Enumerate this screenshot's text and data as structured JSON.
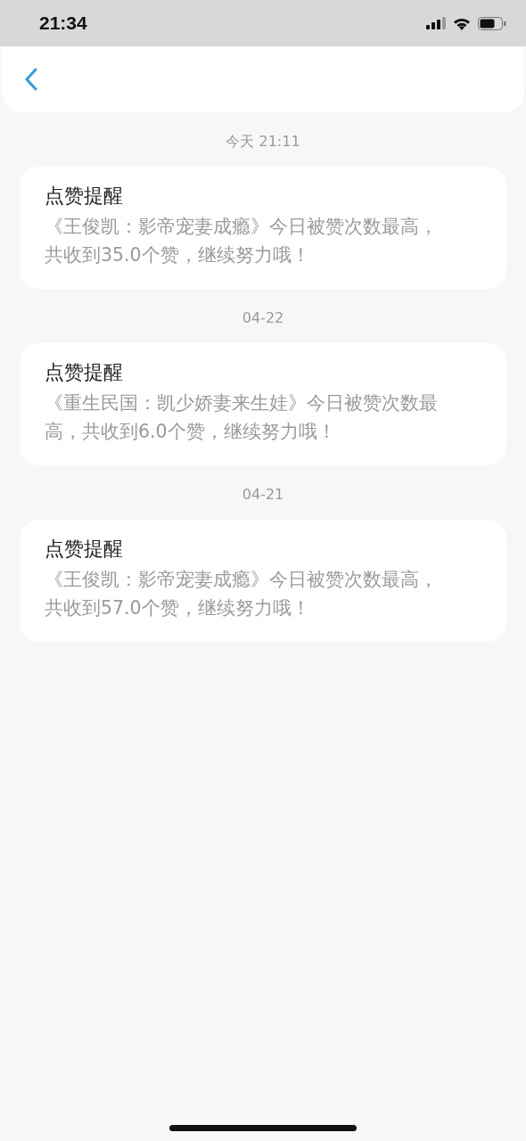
{
  "status_bar": {
    "time": "21:34"
  },
  "notices": [
    {
      "date": "今天 21:11",
      "title": "点赞提醒",
      "body": "《王俊凯：影帝宠妻成瘾》今日被赞次数最高，共收到35.0个赞，继续努力哦！"
    },
    {
      "date": "04-22",
      "title": "点赞提醒",
      "body": "《重生民国：凯少娇妻来生娃》今日被赞次数最高，共收到6.0个赞，继续努力哦！"
    },
    {
      "date": "04-21",
      "title": "点赞提醒",
      "body": "《王俊凯：影帝宠妻成瘾》今日被赞次数最高，共收到57.0个赞，继续努力哦！"
    }
  ]
}
